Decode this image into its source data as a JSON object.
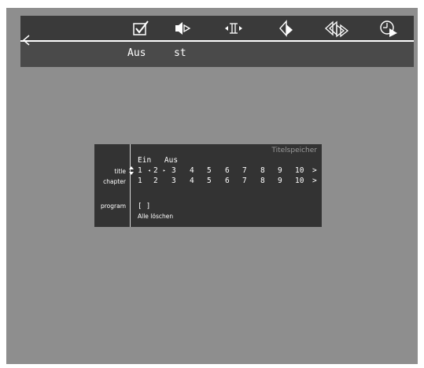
{
  "menu": {
    "items": [
      {
        "name": "checkbox-icon",
        "label": "Aus"
      },
      {
        "name": "audio-next-icon",
        "label": "st"
      },
      {
        "name": "step-icon",
        "label": ""
      },
      {
        "name": "angle-icon",
        "label": ""
      },
      {
        "name": "skip-icon",
        "label": ""
      },
      {
        "name": "time-play-icon",
        "label": ""
      }
    ]
  },
  "panel": {
    "title": "Titelspeicher",
    "ein": "Ein",
    "aus": "Aus",
    "title_label": "title",
    "chapter_label": "chapter",
    "program_label": "program",
    "title_numbers": [
      "1",
      "2",
      "3",
      "4",
      "5",
      "6",
      "7",
      "8",
      "9",
      "10"
    ],
    "chapter_numbers": [
      "1",
      "2",
      "3",
      "4",
      "5",
      "6",
      "7",
      "8",
      "9",
      "10"
    ],
    "more_symbol": ">",
    "program_value": "[ ]",
    "clear_all": "Alle löschen"
  },
  "colors": {
    "background": "#8e8e8e",
    "menu": "#3a3a3a",
    "panel": "#333333",
    "text": "#ffffff"
  }
}
